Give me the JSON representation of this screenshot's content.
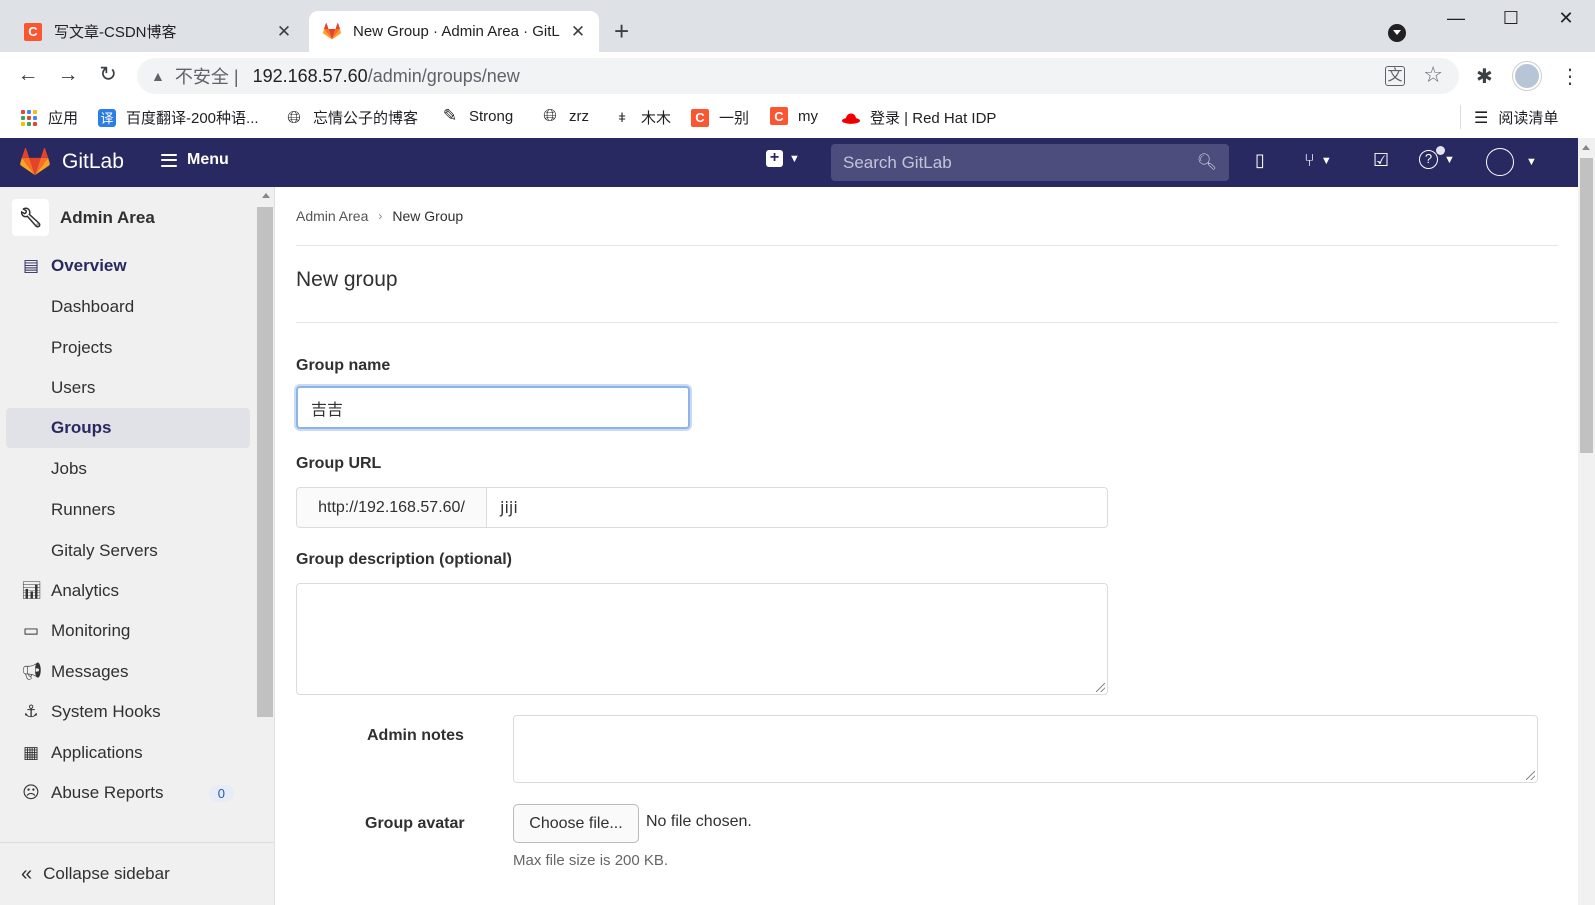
{
  "browser": {
    "tabs": [
      {
        "title": "写文章-CSDN博客",
        "active": false
      },
      {
        "title": "New Group · Admin Area · GitL",
        "active": true
      }
    ],
    "address": {
      "security_label": "不安全",
      "separator": "|",
      "host": "192.168.57.60",
      "path": "/admin/groups/new"
    },
    "bookmarks": [
      {
        "label": "应用",
        "icon": "apps-grid-icon"
      },
      {
        "label": "百度翻译-200种语...",
        "icon": "baidu-translate-icon"
      },
      {
        "label": "忘情公子的博客",
        "icon": "globe-icon"
      },
      {
        "label": "Strong",
        "icon": "strong-icon"
      },
      {
        "label": "zrz",
        "icon": "globe-icon"
      },
      {
        "label": "木木",
        "icon": "pin-icon"
      },
      {
        "label": "一别",
        "icon": "csdn-icon"
      },
      {
        "label": "my",
        "icon": "csdn-icon"
      },
      {
        "label": "登录 | Red Hat IDP",
        "icon": "redhat-icon"
      }
    ],
    "reading_list": "阅读清单"
  },
  "header": {
    "brand": "GitLab",
    "menu_label": "Menu",
    "search_placeholder": "Search GitLab"
  },
  "sidebar": {
    "context_title": "Admin Area",
    "items": [
      {
        "label": "Overview",
        "icon": "overview-icon",
        "level": "top",
        "state": "section-active"
      },
      {
        "label": "Dashboard",
        "level": "sub"
      },
      {
        "label": "Projects",
        "level": "sub"
      },
      {
        "label": "Users",
        "level": "sub"
      },
      {
        "label": "Groups",
        "level": "sub",
        "state": "active"
      },
      {
        "label": "Jobs",
        "level": "sub"
      },
      {
        "label": "Runners",
        "level": "sub"
      },
      {
        "label": "Gitaly Servers",
        "level": "sub"
      },
      {
        "label": "Analytics",
        "icon": "analytics-icon",
        "level": "top"
      },
      {
        "label": "Monitoring",
        "icon": "monitoring-icon",
        "level": "top"
      },
      {
        "label": "Messages",
        "icon": "messages-icon",
        "level": "top"
      },
      {
        "label": "System Hooks",
        "icon": "system-hooks-icon",
        "level": "top"
      },
      {
        "label": "Applications",
        "icon": "applications-icon",
        "level": "top"
      },
      {
        "label": "Abuse Reports",
        "icon": "abuse-reports-icon",
        "level": "top",
        "badge": "0"
      }
    ],
    "collapse_label": "Collapse sidebar"
  },
  "main": {
    "breadcrumb": [
      "Admin Area",
      "New Group"
    ],
    "page_title": "New group",
    "form": {
      "group_name_label": "Group name",
      "group_name_value": "吉吉",
      "group_url_label": "Group URL",
      "group_url_prefix": "http://192.168.57.60/",
      "group_path_value": "jiji",
      "group_description_label": "Group description (optional)",
      "group_description_value": "",
      "admin_notes_label": "Admin notes",
      "admin_notes_value": "",
      "group_avatar_label": "Group avatar",
      "choose_file_label": "Choose file...",
      "no_file_text": "No file chosen.",
      "max_size_text": "Max file size is 200 KB."
    }
  },
  "colors": {
    "header_bg": "#292961",
    "search_bg": "#4c4c7d",
    "sidebar_bg": "#f0f0f0",
    "active_item_bg": "#e1e1e8",
    "focus_ring": "#8eb4e6",
    "gitlab_orange": "#fc6d26"
  }
}
